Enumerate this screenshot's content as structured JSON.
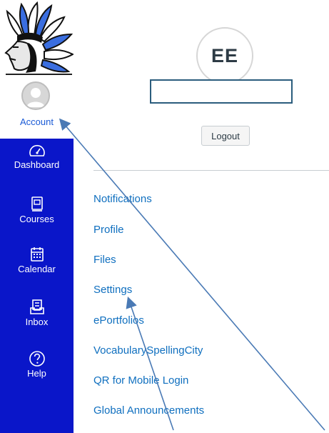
{
  "global_nav": {
    "account_label": "Account",
    "items": [
      {
        "label": "Dashboard",
        "icon": "dashboard-icon"
      },
      {
        "label": "Courses",
        "icon": "courses-icon"
      },
      {
        "label": "Calendar",
        "icon": "calendar-icon"
      },
      {
        "label": "Inbox",
        "icon": "inbox-icon"
      },
      {
        "label": "Help",
        "icon": "help-icon"
      }
    ],
    "background_color": "#0a16c9"
  },
  "account_tray": {
    "avatar_initials": "EE",
    "logout_label": "Logout",
    "links": [
      "Notifications",
      "Profile",
      "Files",
      "Settings",
      "ePortfolios",
      "VocabularySpellingCity",
      "QR for Mobile Login",
      "Global Announcements"
    ],
    "link_color": "#0f6fbf"
  },
  "annotations": {
    "arrow_color": "#4a7ab5"
  }
}
